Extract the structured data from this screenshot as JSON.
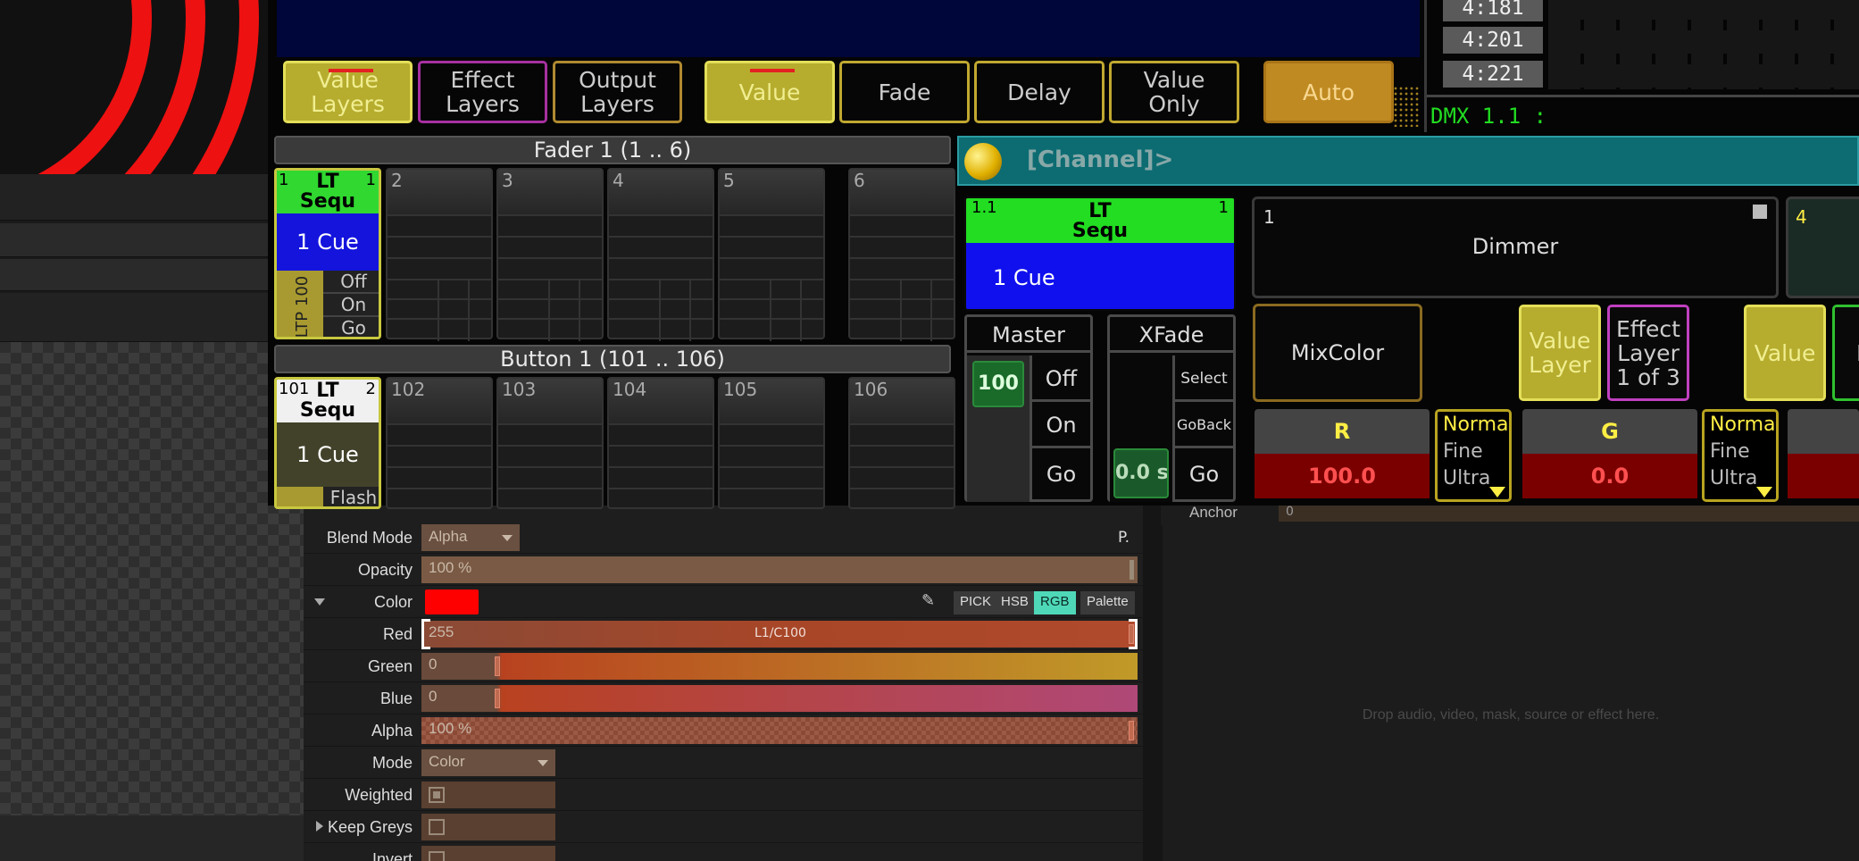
{
  "ma": {
    "layer_buttons": [
      {
        "label_line1": "Value",
        "label_line2": "Layers"
      },
      {
        "label_line1": "Effect",
        "label_line2": "Layers"
      },
      {
        "label_line1": "Output",
        "label_line2": "Layers"
      }
    ],
    "mode_buttons": [
      {
        "label": "Value"
      },
      {
        "label": "Fade"
      },
      {
        "label": "Delay"
      },
      {
        "label_line1": "Value",
        "label_line2": "Only"
      }
    ],
    "auto_label": "Auto",
    "dmx_cells": [
      "4:181",
      "4:201",
      "4:221"
    ],
    "dmx_label": "DMX 1.1 :",
    "fader_section_title": "Fader  1 (1 .. 6)",
    "button_section_title": "Button  1 (101 .. 106)",
    "fader_numbers": [
      "2",
      "3",
      "4",
      "5",
      "6"
    ],
    "button_numbers": [
      "102",
      "103",
      "104",
      "105",
      "106"
    ],
    "exec1": {
      "num": "1",
      "right_num": "1",
      "line1": "LT",
      "line2": "Sequ",
      "cue": "1 Cue",
      "side_label": "LTP 100",
      "buttons": [
        "Off",
        "On",
        "Go"
      ]
    },
    "exec101": {
      "num": "101",
      "right_num": "2",
      "line1": "LT",
      "line2": "Sequ",
      "cue": "1 Cue",
      "flash": "Flash"
    },
    "command_line": "[Channel]>",
    "big_exec": {
      "num": "1.1",
      "right_num": "1",
      "line1": "LT",
      "line2": "Sequ",
      "cue": "1 Cue"
    },
    "master": {
      "title": "Master",
      "value": "100",
      "buttons": [
        "Off",
        "On",
        "Go"
      ]
    },
    "xfade": {
      "title": "XFade",
      "buttons": [
        "Select",
        "GoBack",
        "Go"
      ],
      "value": "0.0 s"
    },
    "dimmer": {
      "num": "1",
      "label": "Dimmer"
    },
    "second_fixture_num": "4",
    "mixcolor_label": "MixColor",
    "value_layer": {
      "line1": "Value",
      "line2": "Layer"
    },
    "effect_layer": {
      "line1": "Effect",
      "line2": "Layer",
      "line3": "1 of 3"
    },
    "value_btn_right": "Value",
    "cut_right_label": "F",
    "attributes": [
      {
        "name": "R",
        "value": "100.0"
      },
      {
        "name": "G",
        "value": "0.0"
      }
    ],
    "resolution": [
      "Norma",
      "Fine",
      "Ultra"
    ]
  },
  "props": {
    "anchor_label": "Anchor",
    "anchor_value": "0",
    "blend_mode": {
      "label": "Blend Mode",
      "value": "Alpha"
    },
    "p_button": "P.",
    "opacity": {
      "label": "Opacity",
      "value": "100 %"
    },
    "color": {
      "label": "Color",
      "swatch": "#ff0000",
      "buttons": [
        "PICK",
        "HSB",
        "RGB",
        "Palette"
      ],
      "active": "RGB"
    },
    "red": {
      "label": "Red",
      "value": "255",
      "mapping": "L1/C100"
    },
    "green": {
      "label": "Green",
      "value": "0"
    },
    "blue": {
      "label": "Blue",
      "value": "0"
    },
    "alpha": {
      "label": "Alpha",
      "value": "100 %"
    },
    "mode": {
      "label": "Mode",
      "value": "Color"
    },
    "weighted": {
      "label": "Weighted",
      "checked": true
    },
    "keep_greys": {
      "label": "Keep Greys",
      "checked": false
    },
    "invert": {
      "label": "Invert",
      "checked": false
    }
  },
  "drop_zone_text": "Drop audio, video, mask, source or effect here."
}
